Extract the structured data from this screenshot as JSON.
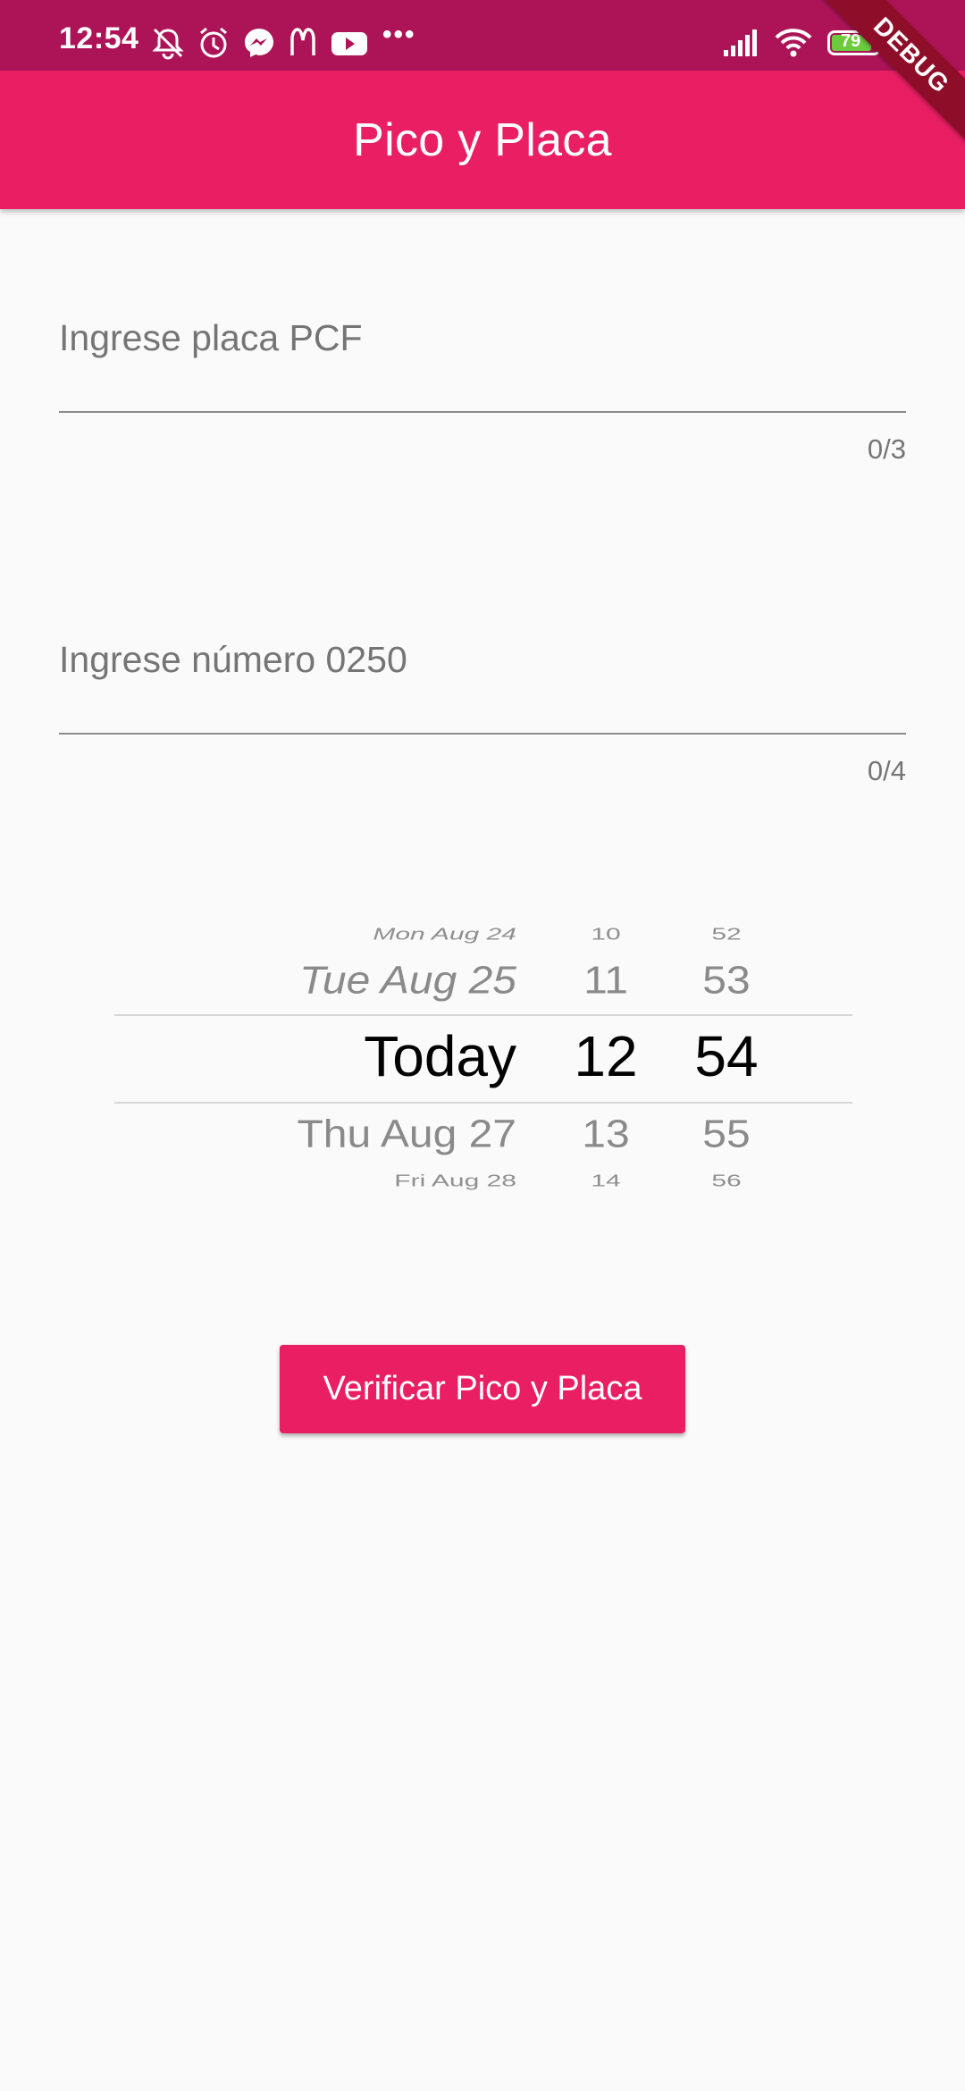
{
  "status_bar": {
    "time": "12:54",
    "battery": "79",
    "icons": [
      "mute-notifications-icon",
      "alarm-icon",
      "messenger-icon",
      "mcdonalds-icon",
      "youtube-icon",
      "more-dots-icon",
      "signal-icon",
      "wifi-icon",
      "battery-icon"
    ],
    "more": "•••"
  },
  "debug_banner": "DEBUG",
  "app_bar": {
    "title": "Pico y Placa"
  },
  "plate_field": {
    "placeholder": "Ingrese placa PCF",
    "value": "",
    "counter": "0/3"
  },
  "number_field": {
    "placeholder": "Ingrese número 0250",
    "value": "",
    "counter": "0/4"
  },
  "picker": {
    "rows": [
      {
        "date": "Mon Aug 24",
        "hour": "10",
        "minute": "52"
      },
      {
        "date": "Tue Aug 25",
        "hour": "11",
        "minute": "53"
      },
      {
        "date": "Today",
        "hour": "12",
        "minute": "54"
      },
      {
        "date": "Thu Aug 27",
        "hour": "13",
        "minute": "55"
      },
      {
        "date": "Fri Aug 28",
        "hour": "14",
        "minute": "56"
      }
    ]
  },
  "verify_button": {
    "label": "Verificar Pico y Placa"
  },
  "colors": {
    "primary": "#e91e63",
    "primary_dark": "#ad1457",
    "background": "#fafafa"
  }
}
